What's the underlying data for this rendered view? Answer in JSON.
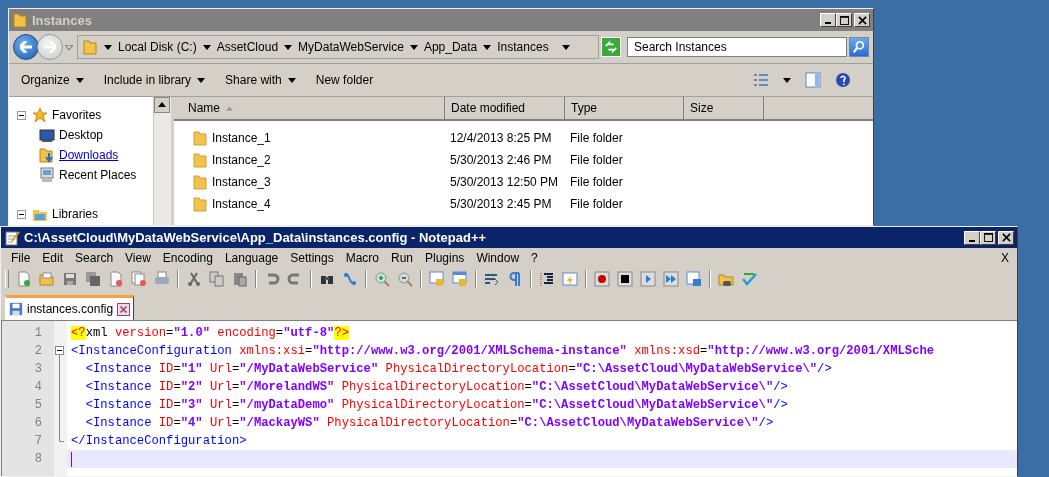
{
  "explorer": {
    "title": "Instances",
    "breadcrumb": [
      "Local Disk (C:)",
      "AssetCloud",
      "MyDataWebService",
      "App_Data",
      "Instances"
    ],
    "search": {
      "placeholder": "Search Instances"
    },
    "commands": [
      {
        "label": "Organize",
        "dropdown": true
      },
      {
        "label": "Include in library",
        "dropdown": true
      },
      {
        "label": "Share with",
        "dropdown": true
      },
      {
        "label": "New folder",
        "dropdown": false
      }
    ],
    "nav": [
      {
        "label": "Favorites",
        "expanded": true,
        "children": [
          {
            "label": "Desktop",
            "hover": false
          },
          {
            "label": "Downloads",
            "hover": true
          },
          {
            "label": "Recent Places",
            "hover": false
          }
        ]
      },
      {
        "label": "Libraries",
        "expanded": true
      }
    ],
    "columns": [
      {
        "label": "Name",
        "sorted": true
      },
      {
        "label": "Date modified",
        "sorted": false
      },
      {
        "label": "Type",
        "sorted": false
      },
      {
        "label": "Size",
        "sorted": false
      }
    ],
    "rows": [
      {
        "name": "Instance_1",
        "date": "12/4/2013 8:25 PM",
        "type": "File folder"
      },
      {
        "name": "Instance_2",
        "date": "5/30/2013 2:46 PM",
        "type": "File folder"
      },
      {
        "name": "Instance_3",
        "date": "5/30/2013 12:50 PM",
        "type": "File folder"
      },
      {
        "name": "Instance_4",
        "date": "5/30/2013 2:45 PM",
        "type": "File folder"
      }
    ]
  },
  "notepad": {
    "title": "C:\\AssetCloud\\MyDataWebService\\App_Data\\instances.config - Notepad++",
    "menu": [
      "File",
      "Edit",
      "Search",
      "View",
      "Encoding",
      "Language",
      "Settings",
      "Macro",
      "Run",
      "Plugins",
      "Window",
      "?"
    ],
    "close_doc": "X",
    "tab": {
      "label": "instances.config"
    },
    "lines": [
      {
        "number": "1",
        "kind": "plain",
        "current": false,
        "tokens": [
          {
            "kind": "pi",
            "text": "<?"
          },
          {
            "kind": "plain",
            "text": "xml"
          },
          {
            "kind": "attr",
            "text": " version"
          },
          {
            "kind": "plain",
            "text": "="
          },
          {
            "kind": "value",
            "text": "\"1.0\""
          },
          {
            "kind": "attr",
            "text": " encoding"
          },
          {
            "kind": "plain",
            "text": "="
          },
          {
            "kind": "value",
            "text": "\"utf-8\""
          },
          {
            "kind": "pi",
            "text": "?>"
          }
        ]
      },
      {
        "number": "2",
        "kind": "fold-start",
        "current": false,
        "tokens": [
          {
            "kind": "tag",
            "text": "<InstanceConfiguration"
          },
          {
            "kind": "attr",
            "text": " xmlns:xsi"
          },
          {
            "kind": "plain",
            "text": "="
          },
          {
            "kind": "value",
            "text": "\"http://www.w3.org/2001/XMLSchema-instance\""
          },
          {
            "kind": "attr",
            "text": " xmlns:xsd"
          },
          {
            "kind": "plain",
            "text": "="
          },
          {
            "kind": "value",
            "text": "\"http://www.w3.org/2001/XMLSche"
          }
        ]
      },
      {
        "number": "3",
        "kind": "fold-body",
        "current": false,
        "tokens": [
          {
            "kind": "tag",
            "text": "  <Instance"
          },
          {
            "kind": "attr",
            "text": " ID"
          },
          {
            "kind": "plain",
            "text": "="
          },
          {
            "kind": "value",
            "text": "\"1\""
          },
          {
            "kind": "attr",
            "text": " Url"
          },
          {
            "kind": "plain",
            "text": "="
          },
          {
            "kind": "value",
            "text": "\"/MyDataWebService\""
          },
          {
            "kind": "attr",
            "text": " PhysicalDirectoryLocation"
          },
          {
            "kind": "plain",
            "text": "="
          },
          {
            "kind": "value",
            "text": "\"C:\\AssetCloud\\MyDataWebService\\\""
          },
          {
            "kind": "tag",
            "text": "/>"
          }
        ]
      },
      {
        "number": "4",
        "kind": "fold-body",
        "current": false,
        "tokens": [
          {
            "kind": "tag",
            "text": "  <Instance"
          },
          {
            "kind": "attr",
            "text": " ID"
          },
          {
            "kind": "plain",
            "text": "="
          },
          {
            "kind": "value",
            "text": "\"2\""
          },
          {
            "kind": "attr",
            "text": " Url"
          },
          {
            "kind": "plain",
            "text": "="
          },
          {
            "kind": "value",
            "text": "\"/MorelandWS\""
          },
          {
            "kind": "attr",
            "text": " PhysicalDirectoryLocation"
          },
          {
            "kind": "plain",
            "text": "="
          },
          {
            "kind": "value",
            "text": "\"C:\\AssetCloud\\MyDataWebService\\\""
          },
          {
            "kind": "tag",
            "text": "/>"
          }
        ]
      },
      {
        "number": "5",
        "kind": "fold-body",
        "current": false,
        "tokens": [
          {
            "kind": "tag",
            "text": "  <Instance"
          },
          {
            "kind": "attr",
            "text": " ID"
          },
          {
            "kind": "plain",
            "text": "="
          },
          {
            "kind": "value",
            "text": "\"3\""
          },
          {
            "kind": "attr",
            "text": " Url"
          },
          {
            "kind": "plain",
            "text": "="
          },
          {
            "kind": "value",
            "text": "\"/myDataDemo\""
          },
          {
            "kind": "attr",
            "text": " PhysicalDirectoryLocation"
          },
          {
            "kind": "plain",
            "text": "="
          },
          {
            "kind": "value",
            "text": "\"C:\\AssetCloud\\MyDataWebService\\\""
          },
          {
            "kind": "tag",
            "text": "/>"
          }
        ]
      },
      {
        "number": "6",
        "kind": "fold-body",
        "current": false,
        "tokens": [
          {
            "kind": "tag",
            "text": "  <Instance"
          },
          {
            "kind": "attr",
            "text": " ID"
          },
          {
            "kind": "plain",
            "text": "="
          },
          {
            "kind": "value",
            "text": "\"4\""
          },
          {
            "kind": "attr",
            "text": " Url"
          },
          {
            "kind": "plain",
            "text": "="
          },
          {
            "kind": "value",
            "text": "\"/MackayWS\""
          },
          {
            "kind": "attr",
            "text": " PhysicalDirectoryLocation"
          },
          {
            "kind": "plain",
            "text": "="
          },
          {
            "kind": "value",
            "text": "\"C:\\AssetCloud\\MyDataWebService\\\""
          },
          {
            "kind": "tag",
            "text": "/>"
          }
        ]
      },
      {
        "number": "7",
        "kind": "fold-end",
        "current": false,
        "tokens": [
          {
            "kind": "tag",
            "text": "</InstanceConfiguration>"
          }
        ]
      },
      {
        "number": "8",
        "kind": "plain",
        "current": true
      }
    ]
  }
}
